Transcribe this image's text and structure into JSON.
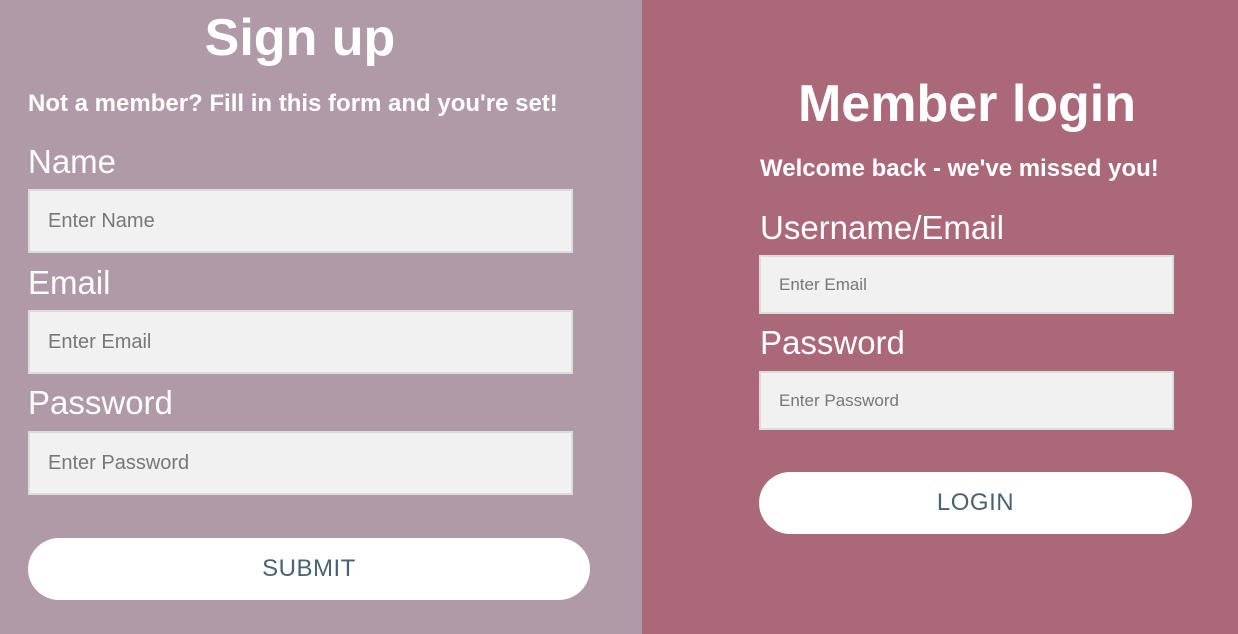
{
  "signup": {
    "title": "Sign up",
    "subtitle": "Not a member? Fill in this form and you're set!",
    "name_label": "Name",
    "name_placeholder": "Enter Name",
    "email_label": "Email",
    "email_placeholder": "Enter Email",
    "password_label": "Password",
    "password_placeholder": "Enter Password",
    "submit_label": "SUBMIT"
  },
  "login": {
    "title": "Member login",
    "subtitle": "Welcome back - we've missed you!",
    "username_label": "Username/Email",
    "username_placeholder": "Enter Email",
    "password_label": "Password",
    "password_placeholder": "Enter Password",
    "login_label": "LOGIN"
  },
  "colors": {
    "signup_background": "#b19aa7",
    "login_background": "#ab6879",
    "button_text": "#4a6370",
    "field_background": "#f1f1f1"
  }
}
